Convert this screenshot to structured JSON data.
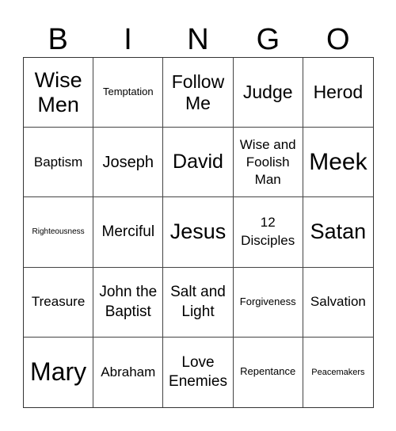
{
  "header": [
    "B",
    "I",
    "N",
    "G",
    "O"
  ],
  "cells": [
    "Wise Men",
    "Temptation",
    "Follow Me",
    "Judge",
    "Herod",
    "Baptism",
    "Joseph",
    "David",
    "Wise and Foolish Man",
    "Meek",
    "Righteousness",
    "Merciful",
    "Jesus",
    "12 Disciples",
    "Satan",
    "Treasure",
    "John the Baptist",
    "Salt and Light",
    "Forgiveness",
    "Salvation",
    "Mary",
    "Abraham",
    "Love Enemies",
    "Repentance",
    "Peacemakers"
  ]
}
